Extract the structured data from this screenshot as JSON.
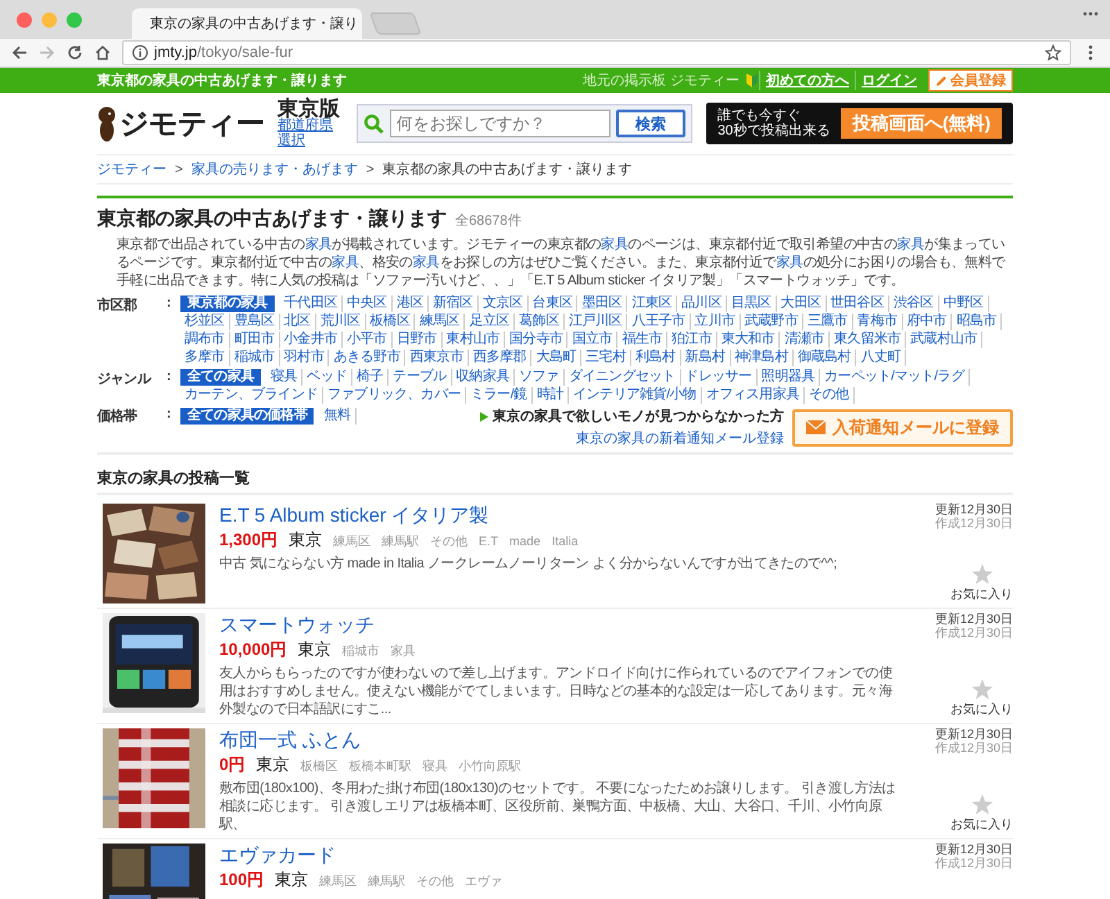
{
  "browser": {
    "tab_title": "東京の家具の中古あげます・譲り",
    "url_host": "jmty.jp",
    "url_path": "/tokyo/sale-fur"
  },
  "topbar": {
    "title": "東京都の家具の中古あげます・譲ります",
    "tagline": "地元の掲示板 ジモティー",
    "links": [
      "初めての方へ",
      "ログイン"
    ],
    "register": "会員登録"
  },
  "header": {
    "logo": "ジモティー",
    "region": "東京版",
    "region_link": "都道府県選択",
    "search_placeholder": "何をお探しですか？",
    "search_button": "検索",
    "promo": [
      "誰でも今すぐ",
      "30秒で投稿出来る"
    ],
    "post_button": "投稿画面へ(無料)"
  },
  "breadcrumb": [
    {
      "text": "ジモティー",
      "link": true
    },
    {
      "separator": ">",
      "text": "家具の売ります・あげます",
      "link": true
    },
    {
      "separator": ">",
      "text": "東京都の家具の中古あげます・譲ります",
      "link": false
    }
  ],
  "heading": {
    "title": "東京都の家具の中古あげます・譲ります",
    "count": "全68678件"
  },
  "description": [
    {
      "text": "東京都で出品されている中古の",
      "link": false
    },
    {
      "text": "家具",
      "link": true
    },
    {
      "text": "が掲載されています。ジモティーの東京都の",
      "link": false
    },
    {
      "text": "家具",
      "link": true
    },
    {
      "text": "のページは、東京都付近で取引希望の中古の",
      "link": false
    },
    {
      "text": "家具",
      "link": true
    },
    {
      "text": "が集まっているページです。東京都付近で中古の",
      "link": false
    },
    {
      "text": "家具",
      "link": true
    },
    {
      "text": "、格安の",
      "link": false
    },
    {
      "text": "家具",
      "link": true
    },
    {
      "text": "をお探しの方はぜひご覧ください。また、東京都付近で",
      "link": false
    },
    {
      "text": "家具",
      "link": true
    },
    {
      "text": "の処分にお困りの場合も、無料で手軽に出品できます。特に人気の投稿は「ソファー汚いけど、、」「E.T 5 Album sticker イタリア製」「スマートウォッチ」です。",
      "link": false
    }
  ],
  "filters": [
    {
      "label": "市区郡",
      "separator": ":",
      "items": [
        {
          "text": "東京都の家具",
          "selected": true
        },
        {
          "text": "千代田区",
          "selected": false
        },
        {
          "text": "中央区",
          "selected": false
        },
        {
          "text": "港区",
          "selected": false
        },
        {
          "text": "新宿区",
          "selected": false
        },
        {
          "text": "文京区",
          "selected": false
        },
        {
          "text": "台東区",
          "selected": false
        },
        {
          "text": "墨田区",
          "selected": false
        },
        {
          "text": "江東区",
          "selected": false
        },
        {
          "text": "品川区",
          "selected": false
        },
        {
          "text": "目黒区",
          "selected": false
        },
        {
          "text": "大田区",
          "selected": false
        },
        {
          "text": "世田谷区",
          "selected": false
        },
        {
          "text": "渋谷区",
          "selected": false
        },
        {
          "text": "中野区",
          "selected": false
        },
        {
          "text": "杉並区",
          "selected": false
        },
        {
          "text": "豊島区",
          "selected": false
        },
        {
          "text": "北区",
          "selected": false
        },
        {
          "text": "荒川区",
          "selected": false
        },
        {
          "text": "板橋区",
          "selected": false
        },
        {
          "text": "練馬区",
          "selected": false
        },
        {
          "text": "足立区",
          "selected": false
        },
        {
          "text": "葛飾区",
          "selected": false
        },
        {
          "text": "江戸川区",
          "selected": false
        },
        {
          "text": "八王子市",
          "selected": false
        },
        {
          "text": "立川市",
          "selected": false
        },
        {
          "text": "武蔵野市",
          "selected": false
        },
        {
          "text": "三鷹市",
          "selected": false
        },
        {
          "text": "青梅市",
          "selected": false
        },
        {
          "text": "府中市",
          "selected": false
        },
        {
          "text": "昭島市",
          "selected": false
        },
        {
          "text": "調布市",
          "selected": false
        },
        {
          "text": "町田市",
          "selected": false
        },
        {
          "text": "小金井市",
          "selected": false
        },
        {
          "text": "小平市",
          "selected": false
        },
        {
          "text": "日野市",
          "selected": false
        },
        {
          "text": "東村山市",
          "selected": false
        },
        {
          "text": "国分寺市",
          "selected": false
        },
        {
          "text": "国立市",
          "selected": false
        },
        {
          "text": "福生市",
          "selected": false
        },
        {
          "text": "狛江市",
          "selected": false
        },
        {
          "text": "東大和市",
          "selected": false
        },
        {
          "text": "清瀬市",
          "selected": false
        },
        {
          "text": "東久留米市",
          "selected": false
        },
        {
          "text": "武蔵村山市",
          "selected": false
        },
        {
          "text": "多摩市",
          "selected": false
        },
        {
          "text": "稲城市",
          "selected": false
        },
        {
          "text": "羽村市",
          "selected": false
        },
        {
          "text": "あきる野市",
          "selected": false
        },
        {
          "text": "西東京市",
          "selected": false
        },
        {
          "text": "西多摩郡",
          "selected": false
        },
        {
          "text": "大島町",
          "selected": false
        },
        {
          "text": "三宅村",
          "selected": false
        },
        {
          "text": "利島村",
          "selected": false
        },
        {
          "text": "新島村",
          "selected": false
        },
        {
          "text": "神津島村",
          "selected": false
        },
        {
          "text": "御蔵島村",
          "selected": false
        },
        {
          "text": "八丈町",
          "selected": false
        }
      ]
    },
    {
      "label": "ジャンル",
      "separator": ":",
      "items": [
        {
          "text": "全ての家具",
          "selected": true
        },
        {
          "text": "寝具",
          "selected": false
        },
        {
          "text": "ベッド",
          "selected": false
        },
        {
          "text": "椅子",
          "selected": false
        },
        {
          "text": "テーブル",
          "selected": false
        },
        {
          "text": "収納家具",
          "selected": false
        },
        {
          "text": "ソファ",
          "selected": false
        },
        {
          "text": "ダイニングセット",
          "selected": false
        },
        {
          "text": "ドレッサー",
          "selected": false
        },
        {
          "text": "照明器具",
          "selected": false
        },
        {
          "text": "カーペット/マット/ラグ",
          "selected": false
        },
        {
          "text": "カーテン、ブラインド",
          "selected": false
        },
        {
          "text": "ファブリック、カバー",
          "selected": false
        },
        {
          "text": "ミラー/鏡",
          "selected": false
        },
        {
          "text": "時計",
          "selected": false
        },
        {
          "text": "インテリア雑貨/小物",
          "selected": false
        },
        {
          "text": "オフィス用家具",
          "selected": false
        },
        {
          "text": "その他",
          "selected": false
        }
      ]
    },
    {
      "label": "価格帯",
      "separator": ":",
      "items": [
        {
          "text": "全ての家具の価格帯",
          "selected": true
        },
        {
          "text": "無料",
          "selected": false
        }
      ]
    }
  ],
  "notify": {
    "text": "東京の家具で欲しいモノが見つからなかった方",
    "link": "東京の家具の新着通知メール登録",
    "button": "入荷通知メールに登録"
  },
  "list_title": "東京の家具の投稿一覧",
  "listings": [
    {
      "title": "E.T 5 Album sticker イタリア製",
      "price": "1,300円",
      "area": "東京",
      "tags": [
        "練馬区",
        "練馬駅",
        "その他",
        "E.T",
        "made",
        "Italia"
      ],
      "body": "中古 気にならない方 made in Italia ノークレームノーリターン よく分からないんですが出てきたので^^;",
      "updated": "更新12月30日",
      "created": "作成12月30日",
      "favorite": "お気に入り"
    },
    {
      "title": "スマートウォッチ",
      "price": "10,000円",
      "area": "東京",
      "tags": [
        "稲城市",
        "家具"
      ],
      "body": "友人からもらったのですが使わないので差し上げます。アンドロイド向けに作られているのでアイフォンでの使用はおすすめしません。使えない機能がでてしまいます。日時などの基本的な設定は一応してあります。元々海外製なので日本語訳にすこ...",
      "updated": "更新12月30日",
      "created": "作成12月30日",
      "favorite": "お気に入り"
    },
    {
      "title": "布団一式 ふとん",
      "price": "0円",
      "area": "東京",
      "tags": [
        "板橋区",
        "板橋本町駅",
        "寝具",
        "小竹向原駅"
      ],
      "body": "敷布団(180x100)、冬用わた掛け布団(180x130)のセットです。 不要になったためお譲りします。 引き渡し方法は相談に応じます。 引き渡しエリアは板橋本町、区役所前、巣鴨方面、中板橋、大山、大谷口、千川、小竹向原駅、",
      "updated": "更新12月30日",
      "created": "作成12月30日",
      "favorite": "お気に入り"
    },
    {
      "title": "エヴァカード",
      "price": "100円",
      "area": "東京",
      "tags": [
        "練馬区",
        "練馬駅",
        "その他",
        "エヴァ"
      ],
      "updated": "更新12月30日",
      "created": "作成12月30日"
    }
  ]
}
